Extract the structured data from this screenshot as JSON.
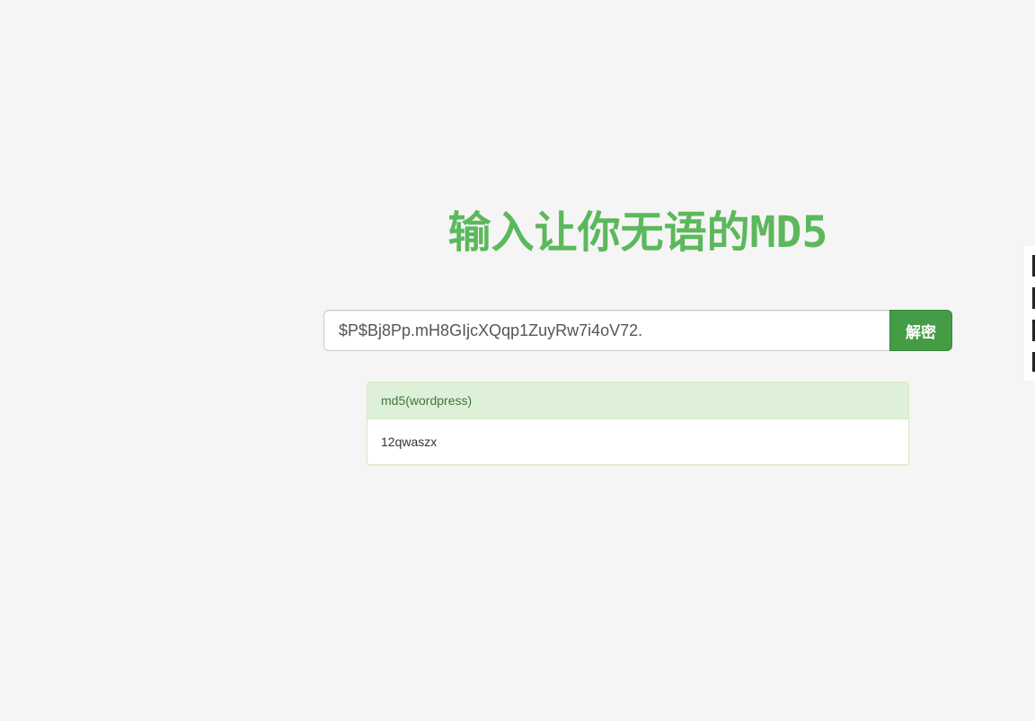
{
  "title": "输入让你无语的MD5",
  "search": {
    "value": "$P$Bj8Pp.mH8GIjcXQqp1ZuyRw7i4oV72.",
    "button_label": "解密"
  },
  "result": {
    "type_label": "md5(wordpress)",
    "plaintext": "12qwaszx"
  },
  "colors": {
    "accent": "#5cb85c",
    "button": "#449d44",
    "panel_heading_bg": "#dff0d8",
    "panel_heading_text": "#3c763d",
    "page_bg": "#f5f5f5"
  }
}
